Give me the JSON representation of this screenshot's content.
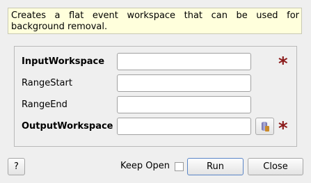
{
  "description": "Creates a flat event workspace that can be used for background removal.",
  "fields": {
    "input_workspace": {
      "label": "InputWorkspace",
      "value": ""
    },
    "range_start": {
      "label": "RangeStart",
      "value": ""
    },
    "range_end": {
      "label": "RangeEnd",
      "value": ""
    },
    "output_workspace": {
      "label": "OutputWorkspace",
      "value": ""
    }
  },
  "required_marker": "*",
  "icons": {
    "browse": "database-icon",
    "required": "asterisk-icon"
  },
  "colors": {
    "description_bg": "#ffffdc",
    "required_marker": "#8b1a1a",
    "default_button_border": "#5a85c6"
  },
  "footer": {
    "help_label": "?",
    "keep_open_label": "Keep Open",
    "keep_open_checked": false,
    "run_label": "Run",
    "close_label": "Close"
  }
}
